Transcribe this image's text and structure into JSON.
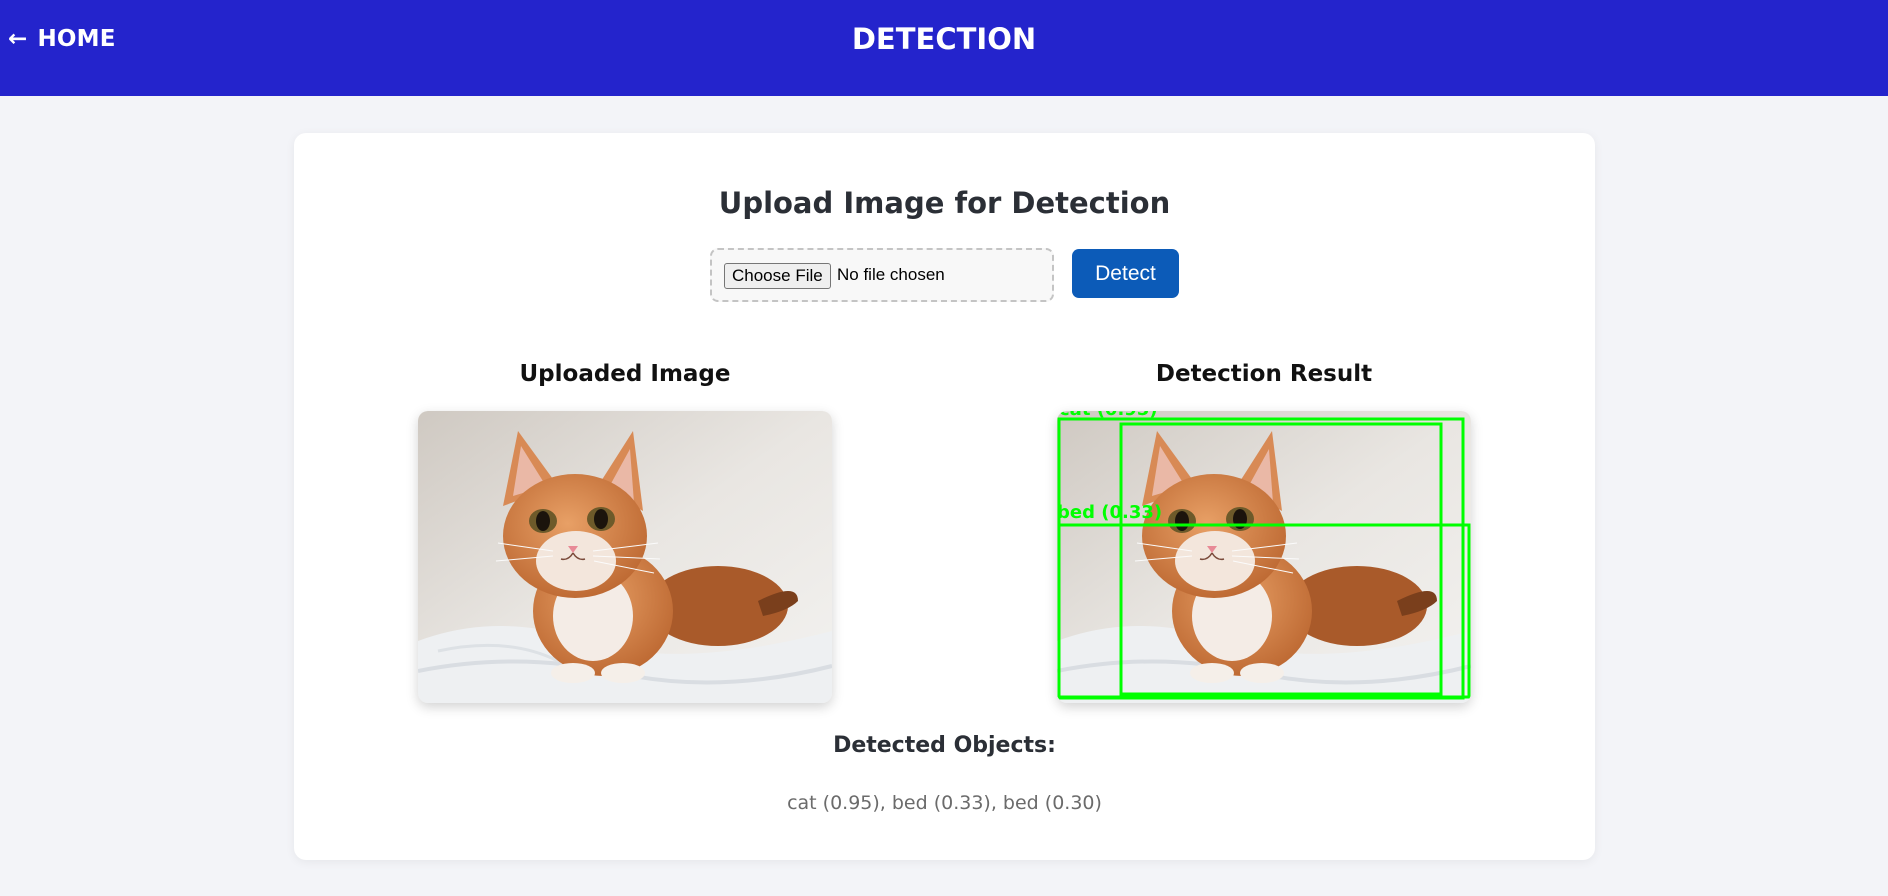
{
  "nav": {
    "home_arrow": "←",
    "home_label": "HOME",
    "title": "DETECTION"
  },
  "upload": {
    "title": "Upload Image for Detection",
    "choose_file_label": "Choose File",
    "no_file_text": "No file chosen",
    "detect_label": "Detect"
  },
  "panels": {
    "uploaded_title": "Uploaded Image",
    "result_title": "Detection Result"
  },
  "detections": {
    "box_labels": [
      "cat (0.95)",
      "bed (0.33)",
      "bed (0.30)"
    ],
    "box_color": "#00ff00"
  },
  "results": {
    "title": "Detected Objects:",
    "list": "cat (0.95), bed (0.33), bed (0.30)"
  },
  "colors": {
    "navbar": "#2424cc",
    "detect_button": "#0c5bb8",
    "background": "#f3f4f8"
  }
}
